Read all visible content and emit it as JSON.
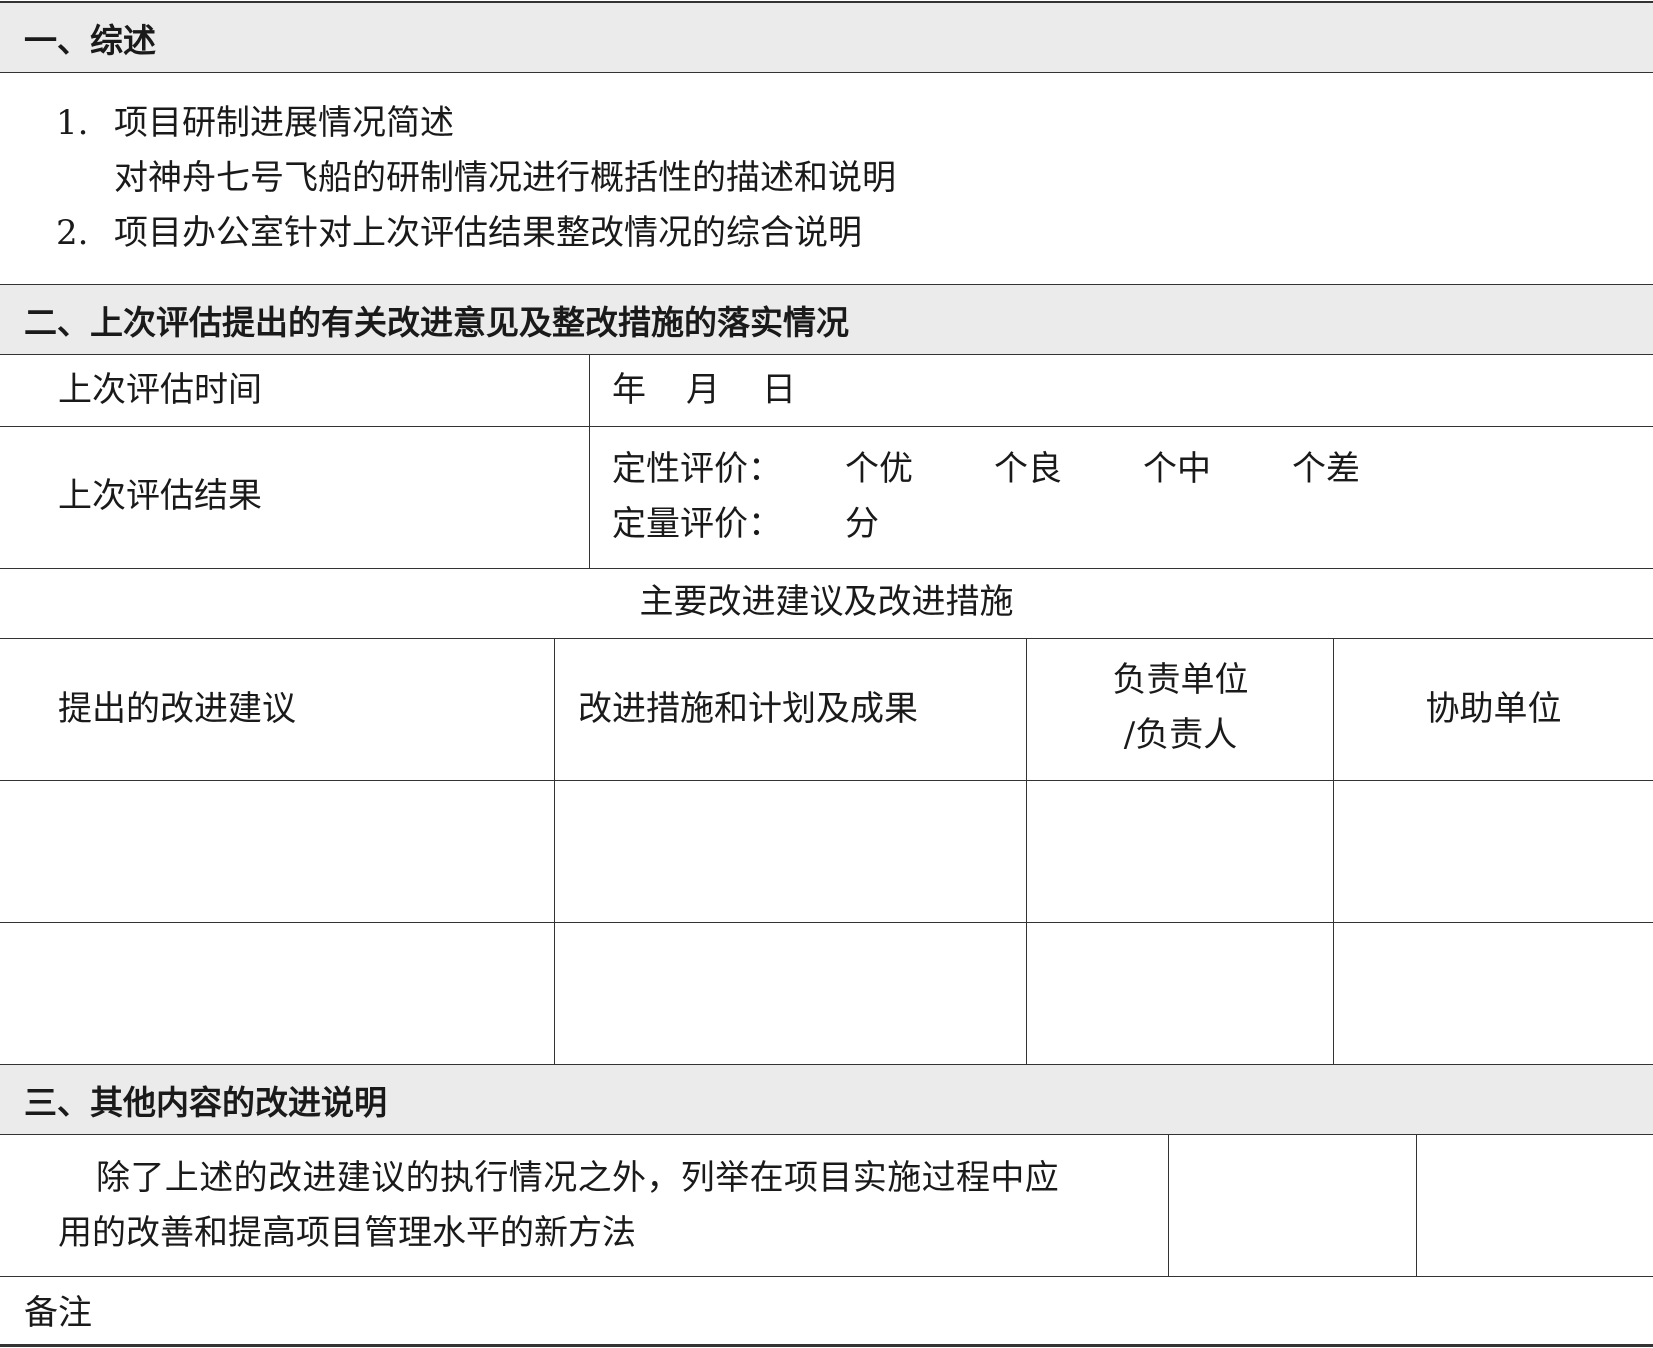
{
  "section1": {
    "title": "一、综述",
    "item1_num": "1.",
    "item1_title": "项目研制进展情况简述",
    "item1_desc": "对神舟七号飞船的研制情况进行概括性的描述和说明",
    "item2_num": "2.",
    "item2_title": "项目办公室针对上次评估结果整改情况的综合说明"
  },
  "section2": {
    "title": "二、上次评估提出的有关改进意见及整改措施的落实情况",
    "last_eval_time_label": "上次评估时间",
    "date_year": "年",
    "date_month": "月",
    "date_day": "日",
    "last_eval_result_label": "上次评估结果",
    "qual_label": "定性评价：",
    "qual_excellent": "个优",
    "qual_good": "个良",
    "qual_medium": "个中",
    "qual_poor": "个差",
    "quant_label": "定量评价：",
    "quant_unit": "分",
    "subtable_title": "主要改进建议及改进措施",
    "col_suggestion": "提出的改进建议",
    "col_measures": "改进措施和计划及成果",
    "col_responsible_line1": "负责单位",
    "col_responsible_line2": "/负责人",
    "col_assist": "协助单位"
  },
  "section3": {
    "title": "三、其他内容的改进说明",
    "text_line1": "除了上述的改进建议的执行情况之外，列举在项目实施过程中应",
    "text_line2": "用的改善和提高项目管理水平的新方法"
  },
  "remarks_label": "备注"
}
